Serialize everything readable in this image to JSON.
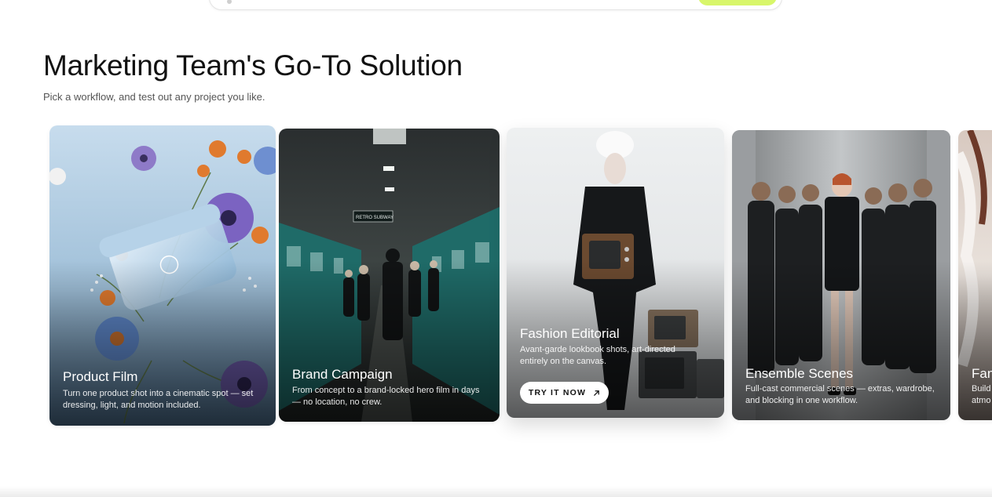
{
  "section": {
    "title": "Marketing Team's Go-To Solution",
    "subtitle": "Pick a workflow, and test out any project you like."
  },
  "cards": [
    {
      "title": "Product Film",
      "description": "Turn one product shot into a cinematic spot — set dressing, light, and motion included."
    },
    {
      "title": "Brand Campaign",
      "description": "From concept to a brand-locked hero film in days — no location, no crew.",
      "sign_text": "RETRO SUBWAY"
    },
    {
      "title": "Fashion Editorial",
      "description": "Avant-garde lookbook shots, art-directed entirely on the canvas.",
      "button_label": "TRY IT NOW",
      "button_icon": "arrow-up-right-icon"
    },
    {
      "title": "Ensemble Scenes",
      "description": "Full-cast commercial scenes — extras, wardrobe, and blocking in one workflow."
    },
    {
      "title": "Fan",
      "description": "Build atmo"
    }
  ],
  "colors": {
    "accent": "#d8f66a",
    "card_text": "#ffffff",
    "subtitle_text": "#555555"
  }
}
